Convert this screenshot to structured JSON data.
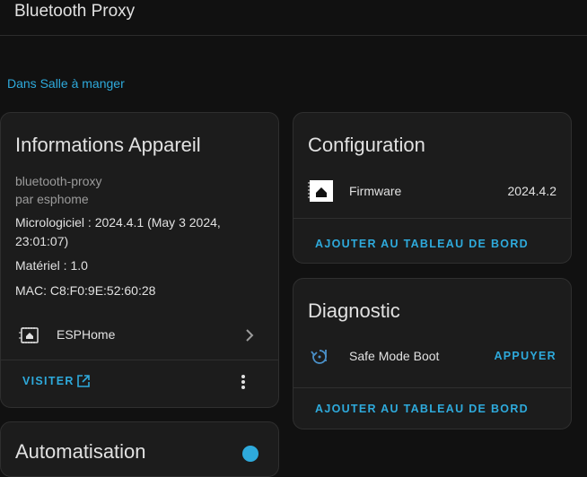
{
  "header": {
    "title": "Bluetooth Proxy"
  },
  "area_link": "Dans Salle à manger",
  "device_info": {
    "title": "Informations Appareil",
    "model": "bluetooth-proxy",
    "manufacturer": "par esphome",
    "firmware_line1": "Micrologiciel : 2024.4.1 (May 3 2024,",
    "firmware_line2": "23:01:07)",
    "hardware": "Matériel : 1.0",
    "mac": "MAC: C8:F0:9E:52:60:28",
    "integration": "ESPHome",
    "visit_label": "VISITER"
  },
  "configuration": {
    "title": "Configuration",
    "entity_name": "Firmware",
    "entity_value": "2024.4.2",
    "add_label": "AJOUTER AU TABLEAU DE BORD"
  },
  "diagnostic": {
    "title": "Diagnostic",
    "entity_name": "Safe Mode Boot",
    "press_label": "APPUYER",
    "add_label": "AJOUTER AU TABLEAU DE BORD"
  },
  "automation": {
    "title": "Automatisation"
  },
  "colors": {
    "accent": "#2eaadc",
    "card": "#1c1c1c",
    "background": "#111111"
  }
}
